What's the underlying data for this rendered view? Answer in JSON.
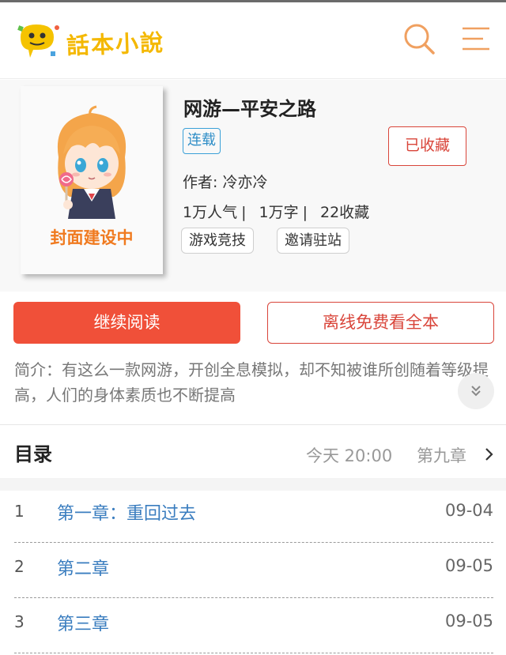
{
  "header": {
    "logo_text": "話本小說",
    "icons": [
      "search-icon",
      "menu-icon"
    ],
    "accent_color": "#f4b800"
  },
  "book": {
    "cover_text": "封面建设中",
    "title": "网游—平安之路",
    "status": "连载",
    "favorite_button": "已收藏",
    "author": "作者: 冷亦冷",
    "stats": {
      "popularity": "1万人气",
      "words": "1万字",
      "favorites": "22收藏",
      "separator": "|"
    },
    "tags": [
      "游戏竞技",
      "邀请驻站"
    ]
  },
  "actions": {
    "continue_reading": "继续阅读",
    "offline_full": "离线免费看全本",
    "primary_color": "#f05039"
  },
  "intro": {
    "text": "简介：有这么一款网游，开创全息模拟，却不知被谁所创随着等级提高，人们的身体素质也不断提高"
  },
  "toc": {
    "title": "目录",
    "updated_time": "今天 20:00",
    "latest_chapter": "第九章",
    "chapters": [
      {
        "num": "1",
        "title": "第一章：重回过去",
        "date": "09-04"
      },
      {
        "num": "2",
        "title": "第二章",
        "date": "09-05"
      },
      {
        "num": "3",
        "title": "第三章",
        "date": "09-05"
      }
    ]
  }
}
